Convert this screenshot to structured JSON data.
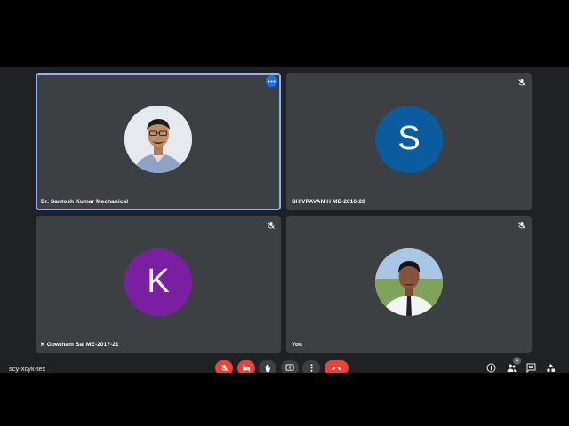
{
  "meeting": {
    "code": "scy-xcyk-tex"
  },
  "participants": [
    {
      "name": "Dr. Santosh Kumar Mechanical",
      "avatar_type": "photo",
      "active_speaker": true,
      "muted": false
    },
    {
      "name": "SHIVPAVAN H ME-2016-20",
      "avatar_type": "initial",
      "initial": "S",
      "avatar_color": "#0b5c9e",
      "muted": true
    },
    {
      "name": "K Gowtham Sai ME-2017-21",
      "avatar_type": "initial",
      "initial": "K",
      "avatar_color": "#7b1fa2",
      "muted": true
    },
    {
      "name": "You",
      "avatar_type": "photo",
      "muted": true
    }
  ],
  "controls": {
    "items": [
      {
        "id": "mic",
        "icon": "mic-off-icon",
        "state": "off"
      },
      {
        "id": "camera",
        "icon": "camera-off-icon",
        "state": "off"
      },
      {
        "id": "raise-hand",
        "icon": "hand-icon"
      },
      {
        "id": "present",
        "icon": "present-icon"
      },
      {
        "id": "more",
        "icon": "more-vert-icon"
      },
      {
        "id": "leave",
        "icon": "call-end-icon"
      }
    ],
    "people_count": "4"
  },
  "colors": {
    "accent": "#8ab4f8",
    "danger": "#ea4335",
    "tile": "#3c4043",
    "background": "#202124"
  }
}
